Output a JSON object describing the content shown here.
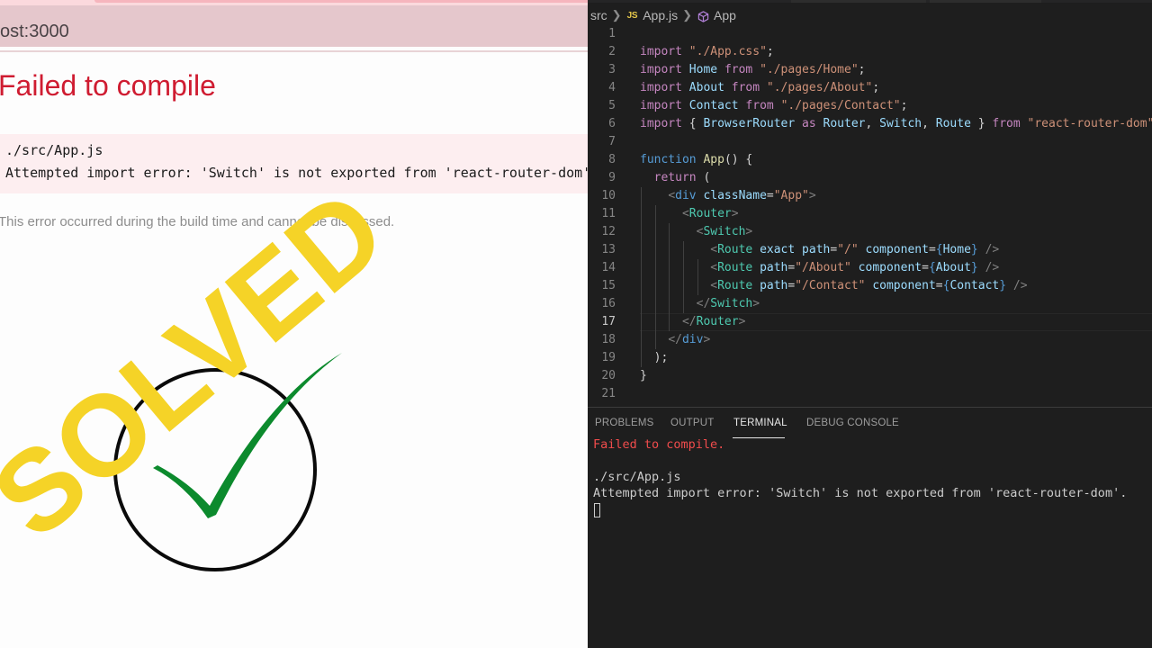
{
  "browser": {
    "address": "ost:3000",
    "error_title": "Failed to compile",
    "error_file": "./src/App.js",
    "error_message": "Attempted import error: 'Switch' is not exported from 'react-router-dom'.",
    "error_note": "This error occurred during the build time and cannot be dismissed.",
    "colors": {
      "error": "#cf1c31",
      "error_bg": "#fdeef0"
    }
  },
  "overlay": {
    "stamp_text": "SOLVED",
    "stamp_color": "#f5d327",
    "check_icon": "check-icon",
    "check_color": "#0c8a2d",
    "circle_icon": "circle-icon"
  },
  "editor": {
    "breadcrumb": {
      "folder": "src",
      "file_badge": "JS",
      "file": "App.js",
      "symbol": "App",
      "symbol_icon": "cube-icon"
    },
    "active_line": 17,
    "lines": [
      {
        "n": "1",
        "tokens": []
      },
      {
        "n": "2",
        "tokens": [
          [
            "kw2",
            "import"
          ],
          [
            "pl",
            " "
          ],
          [
            "str",
            "\"./App.css\""
          ],
          [
            "pl",
            ";"
          ]
        ]
      },
      {
        "n": "3",
        "tokens": [
          [
            "kw2",
            "import"
          ],
          [
            "pl",
            " "
          ],
          [
            "var",
            "Home"
          ],
          [
            "pl",
            " "
          ],
          [
            "kw2",
            "from"
          ],
          [
            "pl",
            " "
          ],
          [
            "str",
            "\"./pages/Home\""
          ],
          [
            "pl",
            ";"
          ]
        ]
      },
      {
        "n": "4",
        "tokens": [
          [
            "kw2",
            "import"
          ],
          [
            "pl",
            " "
          ],
          [
            "var",
            "About"
          ],
          [
            "pl",
            " "
          ],
          [
            "kw2",
            "from"
          ],
          [
            "pl",
            " "
          ],
          [
            "str",
            "\"./pages/About\""
          ],
          [
            "pl",
            ";"
          ]
        ]
      },
      {
        "n": "5",
        "tokens": [
          [
            "kw2",
            "import"
          ],
          [
            "pl",
            " "
          ],
          [
            "var",
            "Contact"
          ],
          [
            "pl",
            " "
          ],
          [
            "kw2",
            "from"
          ],
          [
            "pl",
            " "
          ],
          [
            "str",
            "\"./pages/Contact\""
          ],
          [
            "pl",
            ";"
          ]
        ]
      },
      {
        "n": "6",
        "tokens": [
          [
            "kw2",
            "import"
          ],
          [
            "pl",
            " { "
          ],
          [
            "var",
            "BrowserRouter"
          ],
          [
            "pl",
            " "
          ],
          [
            "kw2",
            "as"
          ],
          [
            "pl",
            " "
          ],
          [
            "var",
            "Router"
          ],
          [
            "pl",
            ", "
          ],
          [
            "var",
            "Switch"
          ],
          [
            "pl",
            ", "
          ],
          [
            "var",
            "Route"
          ],
          [
            "pl",
            " } "
          ],
          [
            "kw2",
            "from"
          ],
          [
            "pl",
            " "
          ],
          [
            "str",
            "\"react-router-dom\""
          ],
          [
            "pl",
            ";"
          ]
        ]
      },
      {
        "n": "7",
        "tokens": []
      },
      {
        "n": "8",
        "tokens": [
          [
            "kw",
            "function"
          ],
          [
            "pl",
            " "
          ],
          [
            "fn",
            "App"
          ],
          [
            "pl",
            "() {"
          ]
        ]
      },
      {
        "n": "9",
        "tokens": [
          [
            "pl",
            "  "
          ],
          [
            "kw2",
            "return"
          ],
          [
            "pl",
            " ("
          ]
        ]
      },
      {
        "n": "10",
        "tokens": [
          [
            "pl",
            "    "
          ],
          [
            "br",
            "<"
          ],
          [
            "kw",
            "div"
          ],
          [
            "pl",
            " "
          ],
          [
            "attr",
            "className"
          ],
          [
            "pl",
            "="
          ],
          [
            "str",
            "\"App\""
          ],
          [
            "br",
            ">"
          ]
        ]
      },
      {
        "n": "11",
        "tokens": [
          [
            "pl",
            "      "
          ],
          [
            "br",
            "<"
          ],
          [
            "tag",
            "Router"
          ],
          [
            "br",
            ">"
          ]
        ]
      },
      {
        "n": "12",
        "tokens": [
          [
            "pl",
            "        "
          ],
          [
            "br",
            "<"
          ],
          [
            "tag",
            "Switch"
          ],
          [
            "br",
            ">"
          ]
        ]
      },
      {
        "n": "13",
        "tokens": [
          [
            "pl",
            "          "
          ],
          [
            "br",
            "<"
          ],
          [
            "tag",
            "Route"
          ],
          [
            "pl",
            " "
          ],
          [
            "attr",
            "exact"
          ],
          [
            "pl",
            " "
          ],
          [
            "attr",
            "path"
          ],
          [
            "pl",
            "="
          ],
          [
            "str",
            "\"/\""
          ],
          [
            "pl",
            " "
          ],
          [
            "attr",
            "component"
          ],
          [
            "pl",
            "="
          ],
          [
            "kw",
            "{"
          ],
          [
            "var",
            "Home"
          ],
          [
            "kw",
            "}"
          ],
          [
            "pl",
            " "
          ],
          [
            "br",
            "/>"
          ]
        ]
      },
      {
        "n": "14",
        "tokens": [
          [
            "pl",
            "          "
          ],
          [
            "br",
            "<"
          ],
          [
            "tag",
            "Route"
          ],
          [
            "pl",
            " "
          ],
          [
            "attr",
            "path"
          ],
          [
            "pl",
            "="
          ],
          [
            "str",
            "\"/About\""
          ],
          [
            "pl",
            " "
          ],
          [
            "attr",
            "component"
          ],
          [
            "pl",
            "="
          ],
          [
            "kw",
            "{"
          ],
          [
            "var",
            "About"
          ],
          [
            "kw",
            "}"
          ],
          [
            "pl",
            " "
          ],
          [
            "br",
            "/>"
          ]
        ]
      },
      {
        "n": "15",
        "tokens": [
          [
            "pl",
            "          "
          ],
          [
            "br",
            "<"
          ],
          [
            "tag",
            "Route"
          ],
          [
            "pl",
            " "
          ],
          [
            "attr",
            "path"
          ],
          [
            "pl",
            "="
          ],
          [
            "str",
            "\"/Contact\""
          ],
          [
            "pl",
            " "
          ],
          [
            "attr",
            "component"
          ],
          [
            "pl",
            "="
          ],
          [
            "kw",
            "{"
          ],
          [
            "var",
            "Contact"
          ],
          [
            "kw",
            "}"
          ],
          [
            "pl",
            " "
          ],
          [
            "br",
            "/>"
          ]
        ]
      },
      {
        "n": "16",
        "tokens": [
          [
            "pl",
            "        "
          ],
          [
            "br",
            "</"
          ],
          [
            "tag",
            "Switch"
          ],
          [
            "br",
            ">"
          ]
        ]
      },
      {
        "n": "17",
        "tokens": [
          [
            "pl",
            "      "
          ],
          [
            "br",
            "</"
          ],
          [
            "tag",
            "Router"
          ],
          [
            "br",
            ">"
          ]
        ]
      },
      {
        "n": "18",
        "tokens": [
          [
            "pl",
            "    "
          ],
          [
            "br",
            "</"
          ],
          [
            "kw",
            "div"
          ],
          [
            "br",
            ">"
          ]
        ]
      },
      {
        "n": "19",
        "tokens": [
          [
            "pl",
            "  );"
          ]
        ]
      },
      {
        "n": "20",
        "tokens": [
          [
            "pl",
            "}"
          ]
        ]
      },
      {
        "n": "21",
        "tokens": []
      }
    ]
  },
  "panel": {
    "tabs": [
      {
        "label": "PROBLEMS",
        "active": false
      },
      {
        "label": "OUTPUT",
        "active": false
      },
      {
        "label": "TERMINAL",
        "active": true
      },
      {
        "label": "DEBUG CONSOLE",
        "active": false
      }
    ],
    "terminal": {
      "line1": "Failed to compile.",
      "line2": "./src/App.js",
      "line3": "Attempted import error: 'Switch' is not exported from 'react-router-dom'."
    }
  }
}
